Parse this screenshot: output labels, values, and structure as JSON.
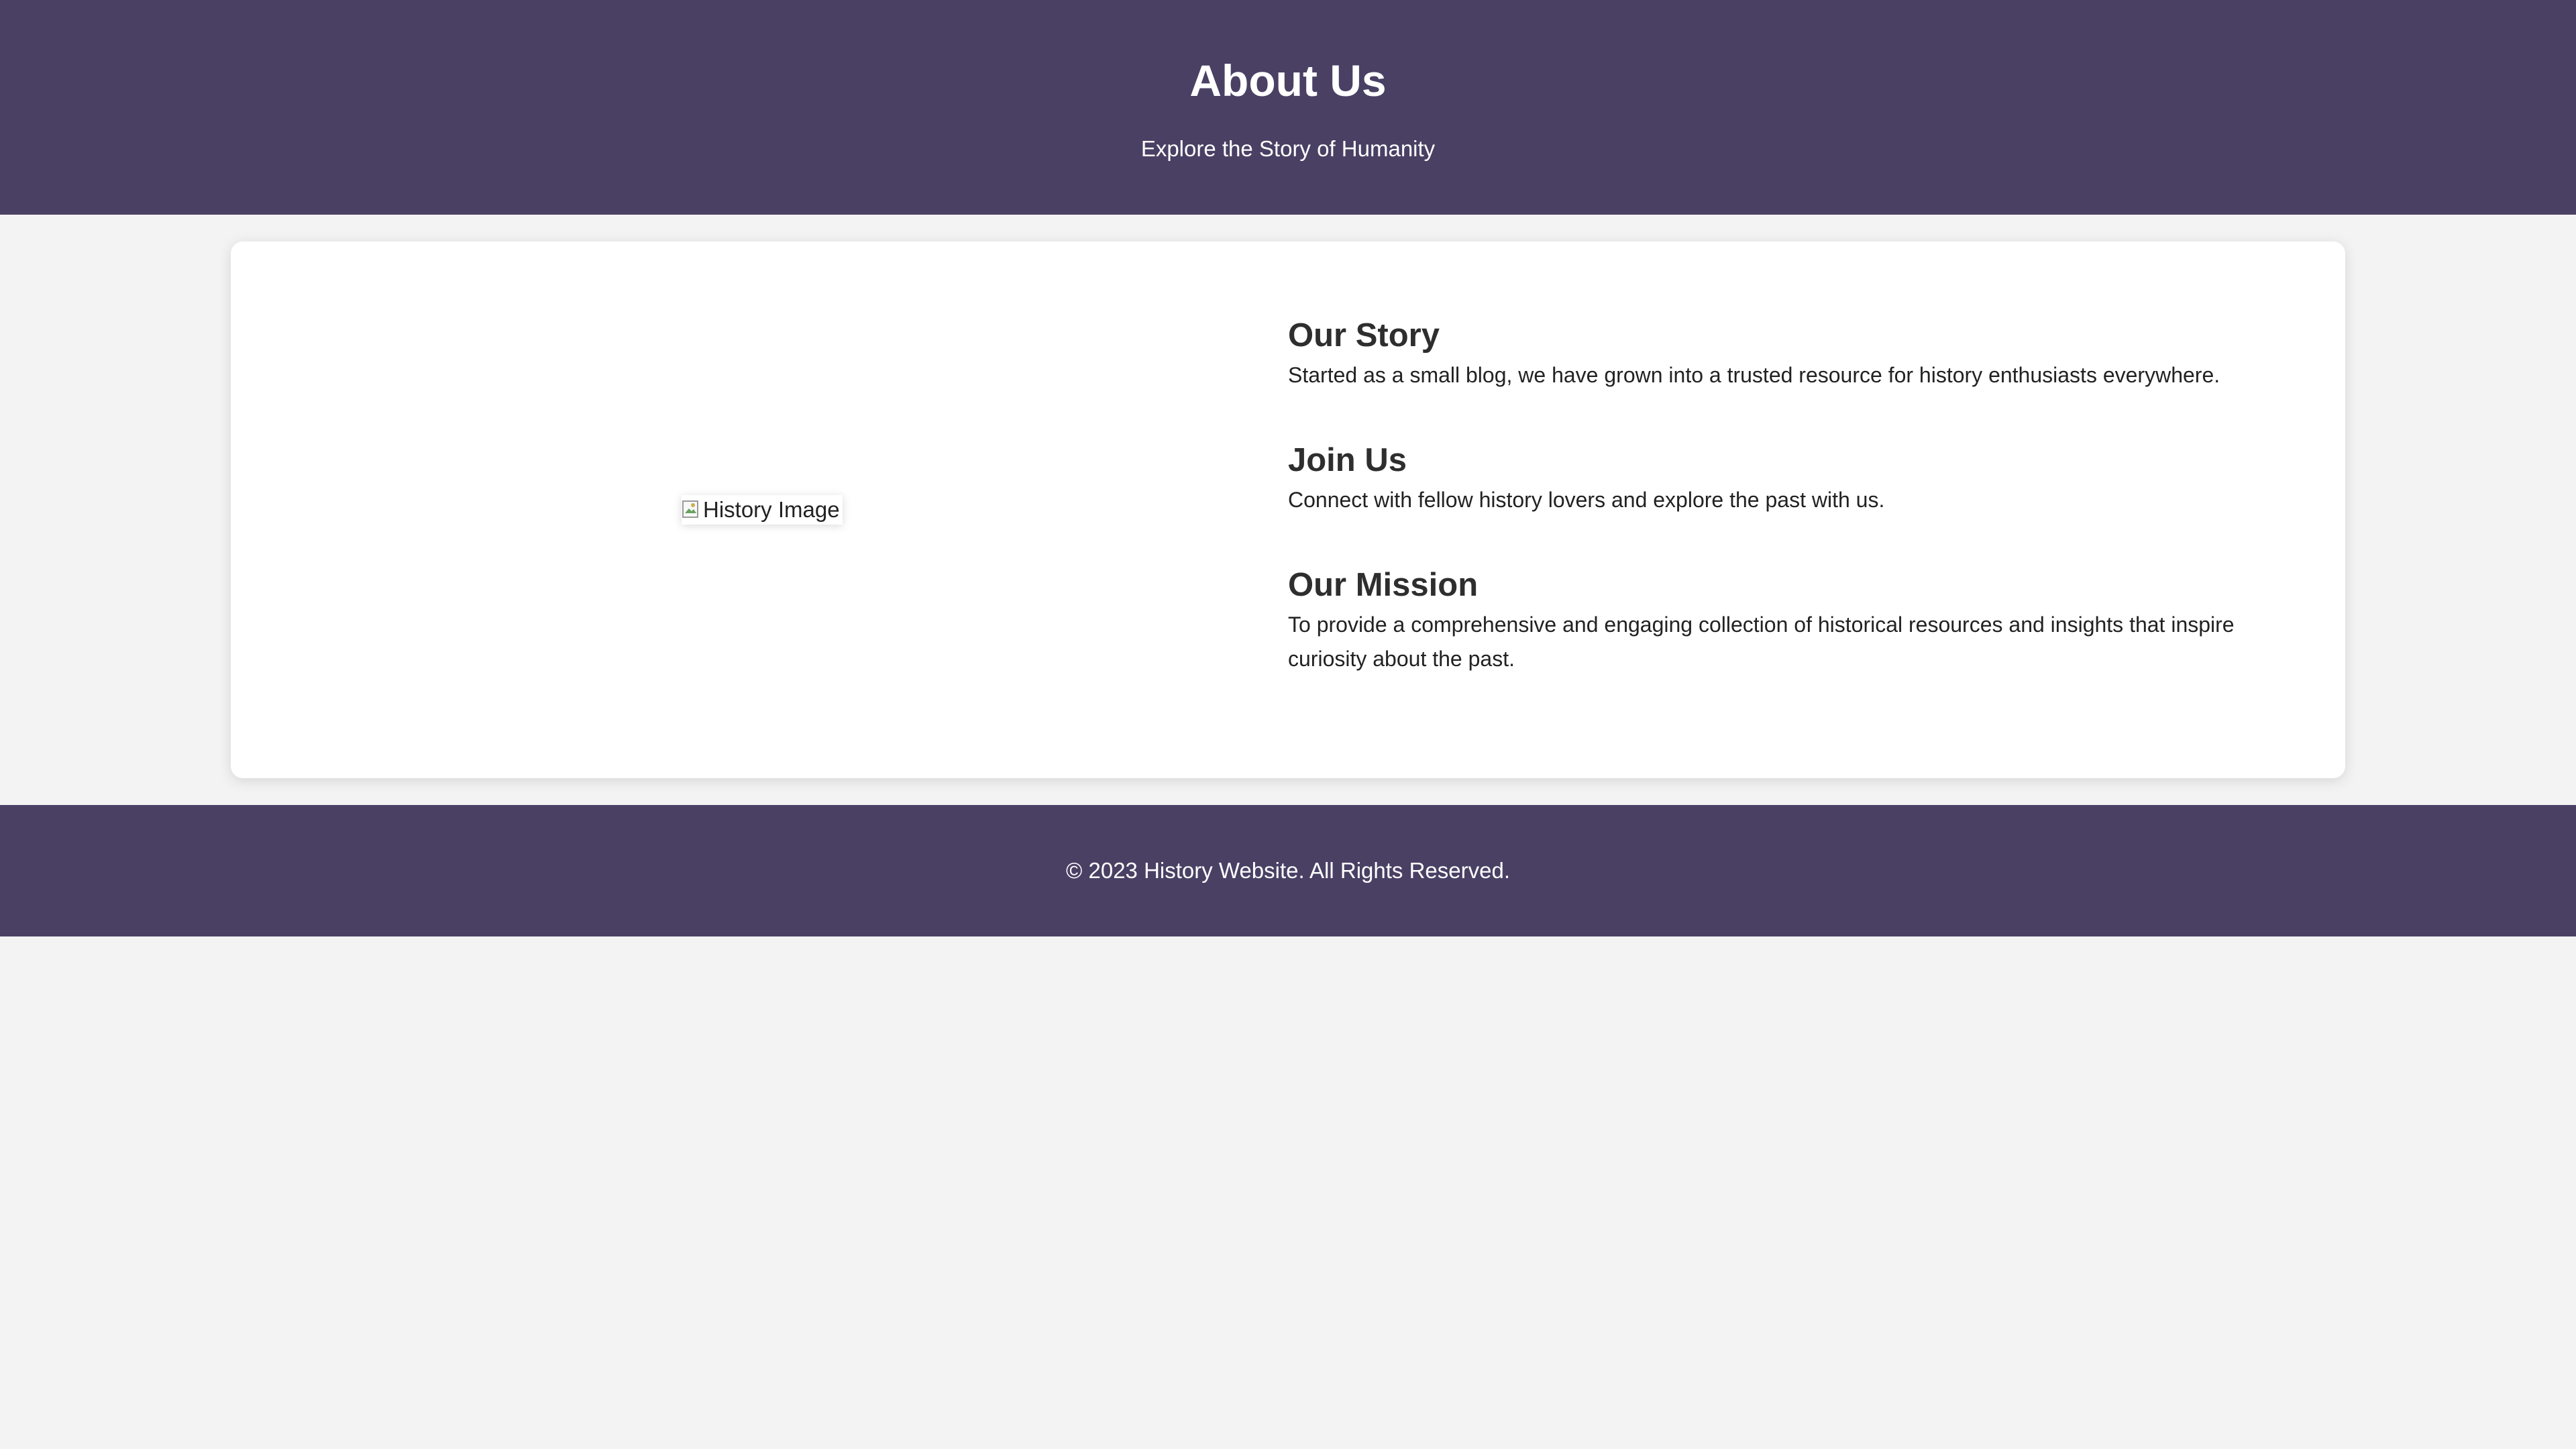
{
  "header": {
    "title": "About Us",
    "subtitle": "Explore the Story of Humanity"
  },
  "image": {
    "alt": "History Image",
    "icon": "broken-image-icon"
  },
  "sections": {
    "story": {
      "title": "Our Story",
      "text": "Started as a small blog, we have grown into a trusted resource for history enthusiasts everywhere."
    },
    "join": {
      "title": "Join Us",
      "text": "Connect with fellow history lovers and explore the past with us."
    },
    "mission": {
      "title": "Our Mission",
      "text": "To provide a comprehensive and engaging collection of historical resources and insights that inspire curiosity about the past."
    }
  },
  "footer": {
    "copyright": "© 2023 History Website. All Rights Reserved."
  },
  "colors": {
    "header_bg": "#4a4064",
    "page_bg": "#f3f3f3",
    "card_bg": "#ffffff",
    "heading_text": "#2e2e2e",
    "body_text": "#222222"
  }
}
